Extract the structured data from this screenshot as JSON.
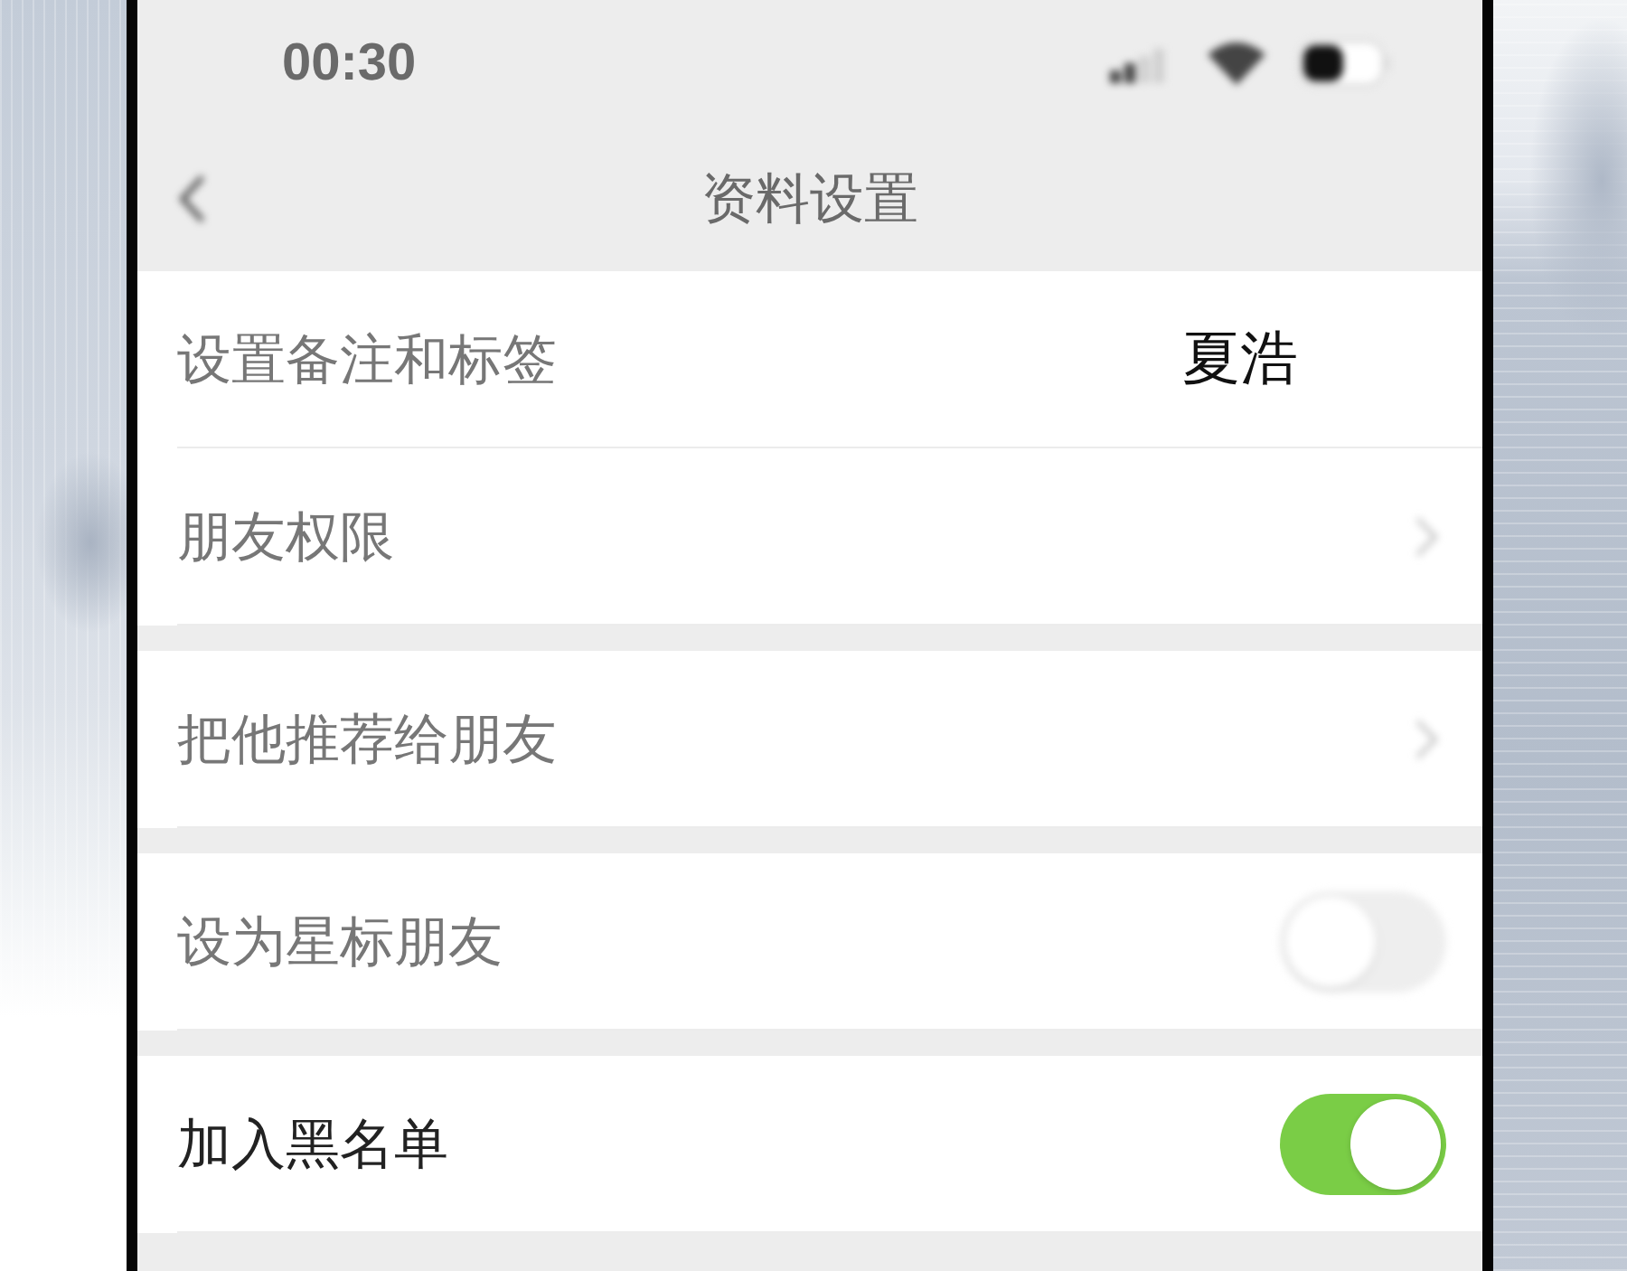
{
  "status_bar": {
    "time": "00:30",
    "blurred": true
  },
  "nav_bar": {
    "title": "资料设置",
    "blurred": true
  },
  "groups": [
    {
      "rows": [
        {
          "kind": "value",
          "label": "设置备注和标签",
          "value": "夏浩",
          "blurred": true
        },
        {
          "kind": "link",
          "label": "朋友权限",
          "blurred": true
        }
      ]
    },
    {
      "rows": [
        {
          "kind": "link",
          "label": "把他推荐给朋友",
          "blurred": true
        }
      ]
    },
    {
      "rows": [
        {
          "kind": "toggle",
          "label": "设为星标朋友",
          "on": false,
          "blurred": true
        }
      ]
    },
    {
      "rows": [
        {
          "kind": "toggle",
          "label": "加入黑名单",
          "on": true,
          "blurred": false
        }
      ]
    }
  ]
}
